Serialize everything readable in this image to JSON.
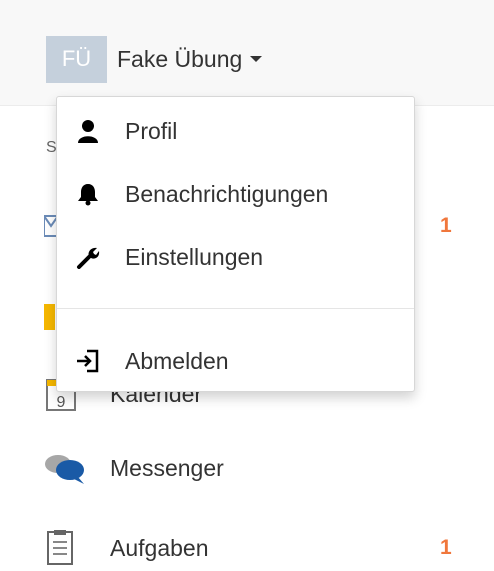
{
  "header": {
    "avatar_initials": "FÜ",
    "user_name": "Fake Übung"
  },
  "sidebar": {
    "peek_text": "S",
    "items": [
      {
        "label": "",
        "count": "1",
        "icon": "mail-icon"
      },
      {
        "label": "",
        "count": "",
        "icon": "badge-icon"
      },
      {
        "label": "Kalender",
        "count": "",
        "icon": "calendar-icon"
      },
      {
        "label": "Messenger",
        "count": "",
        "icon": "chat-icon"
      },
      {
        "label": "Aufgaben",
        "count": "1",
        "icon": "clipboard-icon"
      }
    ]
  },
  "dropdown": {
    "items": [
      {
        "label": "Profil",
        "icon": "user-icon"
      },
      {
        "label": "Benachrichtigungen",
        "icon": "bell-icon"
      },
      {
        "label": "Einstellungen",
        "icon": "wrench-icon"
      },
      {
        "label": "Abmelden",
        "icon": "logout-icon"
      }
    ]
  },
  "colors": {
    "accent_count": "#f0773c",
    "avatar_bg": "#c5d0dc",
    "chat_blue": "#1a5aa6"
  }
}
